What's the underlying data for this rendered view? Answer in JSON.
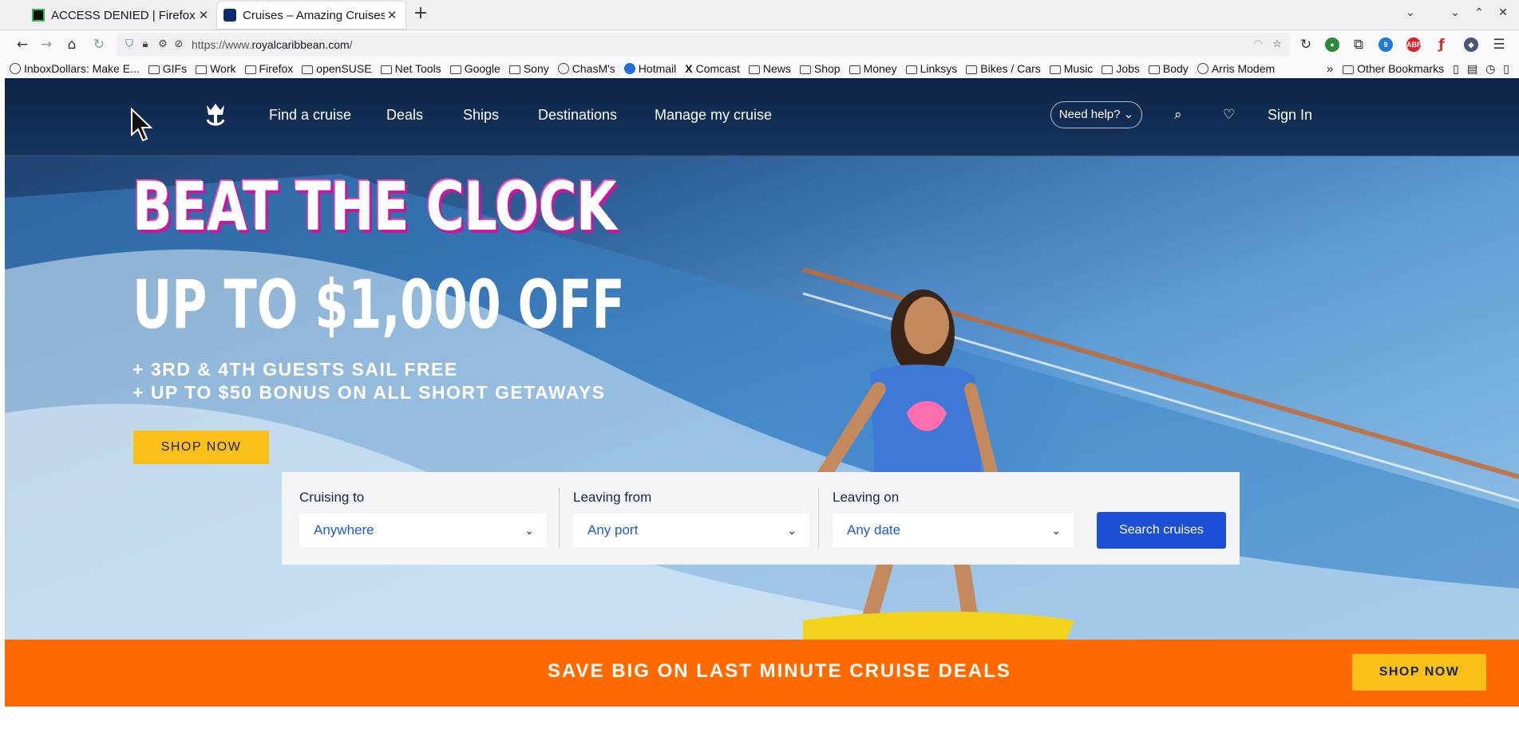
{
  "browser": {
    "tabs": [
      {
        "title": "ACCESS DENIED | Firefox Sup",
        "close": "✕"
      },
      {
        "title": "Cruises – Amazing Cruises ar",
        "close": "✕"
      }
    ],
    "new_tab": "+",
    "url_prefix": "https://www.",
    "url_domain": "royalcaribbean.com",
    "url_suffix": "/",
    "extension_badge": "9",
    "abp_label": "ABP",
    "bookmarks": [
      {
        "label": "InboxDollars: Make E...",
        "icon": "globe-icon"
      },
      {
        "label": "GIFs",
        "icon": "folder-icon"
      },
      {
        "label": "Work",
        "icon": "folder-icon"
      },
      {
        "label": "Firefox",
        "icon": "folder-icon"
      },
      {
        "label": "openSUSE",
        "icon": "folder-icon"
      },
      {
        "label": "Net Tools",
        "icon": "folder-icon"
      },
      {
        "label": "Google",
        "icon": "folder-icon"
      },
      {
        "label": "Sony",
        "icon": "folder-icon"
      },
      {
        "label": "ChasM's",
        "icon": "globe-icon"
      },
      {
        "label": "Hotmail",
        "icon": "outlook-icon"
      },
      {
        "label": "Comcast",
        "icon": "x-icon"
      },
      {
        "label": "News",
        "icon": "folder-icon"
      },
      {
        "label": "Shop",
        "icon": "folder-icon"
      },
      {
        "label": "Money",
        "icon": "folder-icon"
      },
      {
        "label": "Linksys",
        "icon": "folder-icon"
      },
      {
        "label": "Bikes / Cars",
        "icon": "folder-icon"
      },
      {
        "label": "Music",
        "icon": "folder-icon"
      },
      {
        "label": "Jobs",
        "icon": "folder-icon"
      },
      {
        "label": "Body",
        "icon": "folder-icon"
      },
      {
        "label": "Arris Modem",
        "icon": "globe-icon"
      }
    ],
    "other_bookmarks": "Other Bookmarks"
  },
  "site": {
    "nav": [
      "Find a cruise",
      "Deals",
      "Ships",
      "Destinations",
      "Manage my cruise"
    ],
    "need_help": "Need help?",
    "sign_in": "Sign In"
  },
  "hero": {
    "headline1": "BEAT THE CLOCK",
    "headline2": "UP TO $1,000 OFF",
    "promo1": "+ 3RD & 4TH GUESTS SAIL FREE",
    "promo2": "+ UP TO $50 BONUS ON ALL SHORT GETAWAYS",
    "cta": "SHOP NOW"
  },
  "search": {
    "cruising_to": {
      "label": "Cruising to",
      "value": "Anywhere"
    },
    "leaving_from": {
      "label": "Leaving from",
      "value": "Any port"
    },
    "leaving_on": {
      "label": "Leaving on",
      "value": "Any date"
    },
    "button": "Search cruises"
  },
  "banner": {
    "text": "SAVE BIG ON LAST MINUTE CRUISE DEALS",
    "cta": "SHOP NOW"
  },
  "colors": {
    "banner": "#fe6900",
    "cta_yellow": "#fbbf1a",
    "search_blue": "#1d4fd6",
    "headline_magenta": "#c8179c"
  }
}
